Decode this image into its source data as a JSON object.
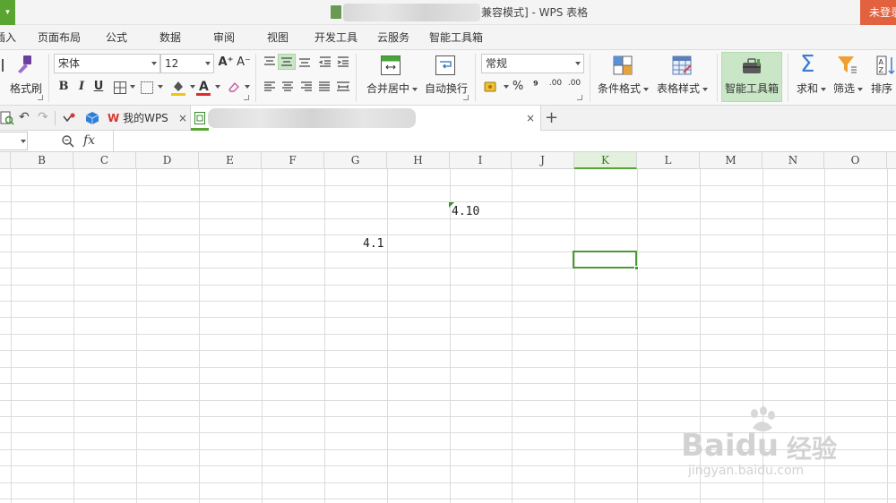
{
  "titlebar": {
    "app_menu_caret": "▾",
    "title_suffix": "兼容模式] - WPS 表格",
    "login_label": "未登录"
  },
  "menu": {
    "tabs": [
      "插入",
      "页面布局",
      "公式",
      "数据",
      "审阅",
      "视图",
      "开发工具",
      "云服务",
      "智能工具箱"
    ]
  },
  "ribbon": {
    "format_painter_label": "格式刷",
    "font_name": "宋体",
    "font_size": "12",
    "grow_font": "A⁺",
    "shrink_font": "A⁻",
    "bold": "B",
    "italic": "I",
    "underline": "U",
    "merge_center_label": "合并居中",
    "wrap_text_label": "自动换行",
    "number_format": "常规",
    "percent": "%",
    "comma": "⁹",
    "increase_decimal": ".00",
    "decrease_decimal": ".00",
    "conditional_format_label": "条件格式",
    "table_style_label": "表格样式",
    "smart_toolbox_label": "智能工具箱",
    "sum_label": "求和",
    "filter_label": "筛选",
    "sort_label": "排序"
  },
  "doctabs": {
    "my_wps_label": "我的WPS",
    "close_glyph": "×",
    "new_tab_glyph": "+"
  },
  "formula": {
    "fx_label": "fx"
  },
  "sheet": {
    "columns": [
      "B",
      "C",
      "D",
      "E",
      "F",
      "G",
      "H",
      "I",
      "J",
      "K",
      "L",
      "M",
      "N",
      "O"
    ],
    "selected_column": "K",
    "cells": {
      "I_row2": "4.10",
      "G_row4": "4.1"
    }
  },
  "watermark": {
    "brand": "Baidu",
    "brand_cn": "经验",
    "url": "jingyan.baidu.com"
  },
  "colors": {
    "accent_green": "#5aa532",
    "login_orange": "#e2613e",
    "selection_green": "#4a9a33"
  }
}
